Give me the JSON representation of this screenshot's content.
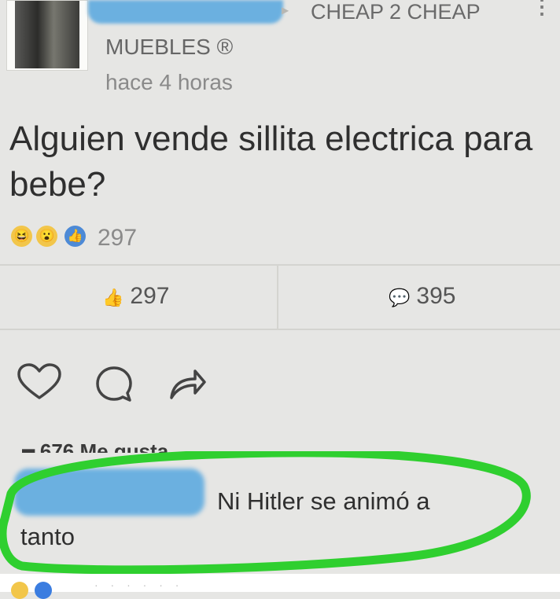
{
  "post": {
    "group_name": "CHEAP 2 CHEAP",
    "page_name": "MUEBLES ®",
    "time": "hace 4 horas",
    "text": "Alguien vende sillita electrica para bebe?",
    "reaction_count": "297",
    "like_count": "297",
    "comment_count": "395",
    "more_icon": "⋮"
  },
  "icons": {
    "reaction_1": "haha-icon",
    "reaction_2": "wow-icon",
    "reaction_3": "like-reaction-icon",
    "like": "thumbs-up-icon",
    "comment": "comment-icon",
    "heart": "heart-icon",
    "bubble": "chat-bubble-icon",
    "share": "share-arrow-icon"
  },
  "comment": {
    "text_line1": "Ni Hitler se animó a",
    "text_line2": "tanto"
  },
  "colors": {
    "highlight_ring": "#2fcf2f",
    "blur": "#6bb0e0",
    "background": "#e6e6e4"
  }
}
